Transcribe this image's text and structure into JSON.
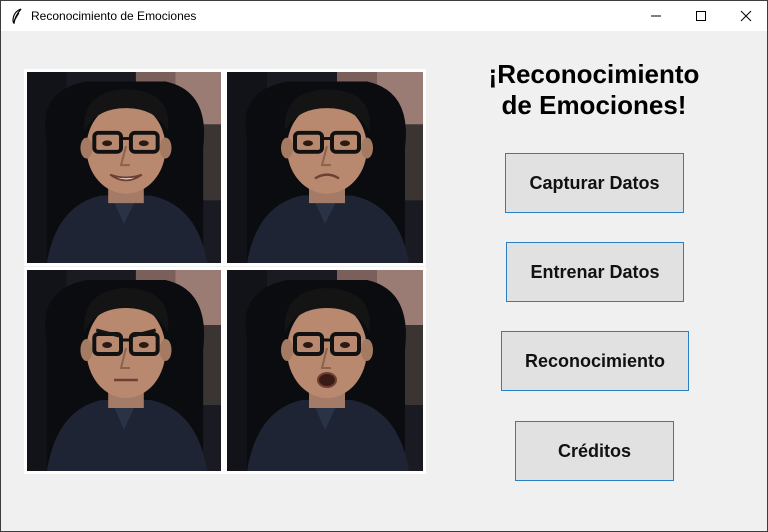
{
  "window": {
    "title": "Reconocimiento de Emociones",
    "app_icon": "feather-icon",
    "controls": [
      "minimize-icon",
      "maximize-icon",
      "close-icon"
    ]
  },
  "photos": [
    {
      "expression": "happy"
    },
    {
      "expression": "sad"
    },
    {
      "expression": "angry"
    },
    {
      "expression": "surprised"
    }
  ],
  "heading": {
    "line1": "¡Reconocimiento",
    "line2": "de Emociones!"
  },
  "buttons": {
    "capture": "Capturar Datos",
    "train": "Entrenar Datos",
    "recognize": "Reconocimiento",
    "credits": "Créditos"
  },
  "colors": {
    "window_bg": "#f0f0f0",
    "button_bg": "#e1e1e1",
    "button_border": "#2a7fc4"
  }
}
